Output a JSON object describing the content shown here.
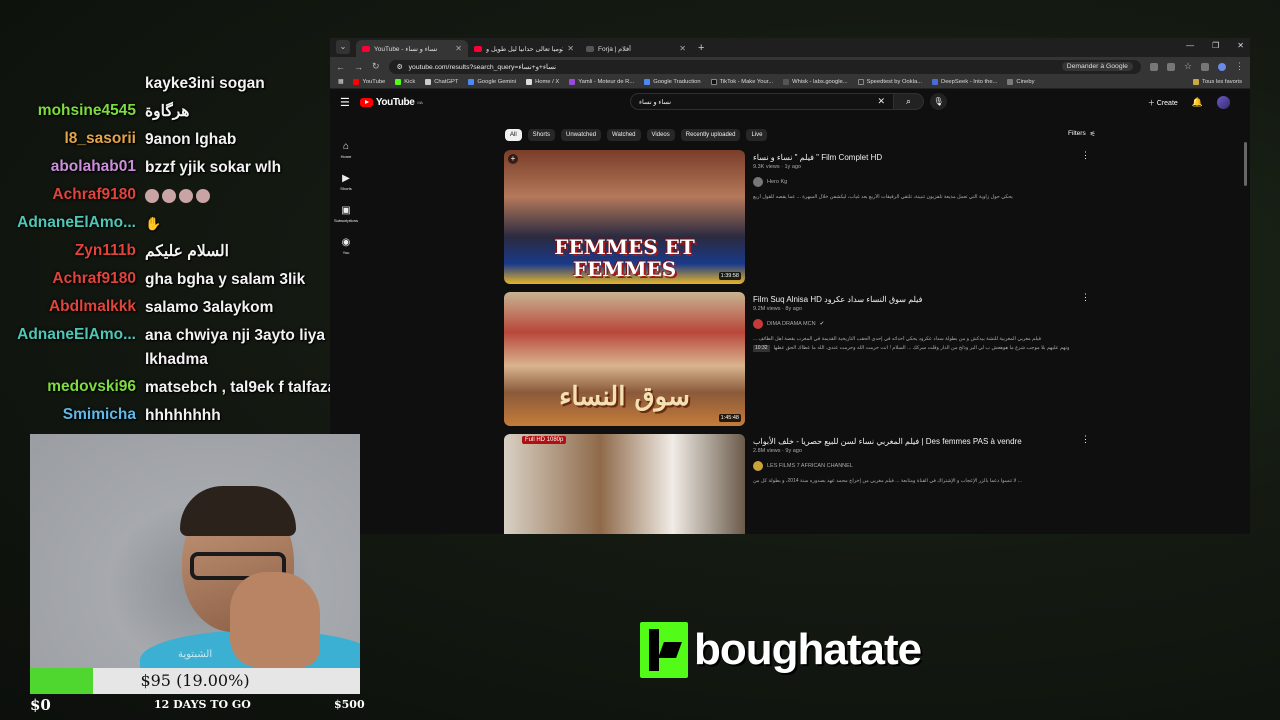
{
  "chat": [
    {
      "user": "",
      "color": "#ffffff",
      "msg": "kayke3ini sogan"
    },
    {
      "user": "mohsine4545",
      "color": "#7ddc3f",
      "msg": "هرگاوة"
    },
    {
      "user": "l8_sasorii",
      "color": "#e3a44a",
      "msg": "9anon lghab"
    },
    {
      "user": "abolahab01",
      "color": "#c98fd8",
      "msg": "bzzf yjik sokar wlh"
    },
    {
      "user": "Achraf9180",
      "color": "#e0443c",
      "msg": ""
    },
    {
      "user": "AdnaneElAmo...",
      "color": "#4fc6b6",
      "msg": ""
    },
    {
      "user": "Zyn111b",
      "color": "#e0443c",
      "msg": "السلام عليكم"
    },
    {
      "user": "Achraf9180",
      "color": "#e0443c",
      "msg": "gha bgha y salam 3lik"
    },
    {
      "user": "Abdlmalkkk",
      "color": "#e0443c",
      "msg": "salamo 3alaykom"
    },
    {
      "user": "AdnaneElAmo...",
      "color": "#4fc6b6",
      "msg": "ana chwiya nji 3ayto liya lkhadma"
    },
    {
      "user": "medovski96",
      "color": "#7ddc3f",
      "msg": "matsebch , tal9ek f talfaza"
    },
    {
      "user": "Smimicha",
      "color": "#5fb8e8",
      "msg": "hhhhhhhh"
    }
  ],
  "browser": {
    "tabs": [
      {
        "title": "YouTube - نساء و نساء",
        "active": true
      },
      {
        "title": "الكوميا تعالى حدانيا ليل طويل و ...",
        "active": false
      },
      {
        "title": "Forja | أفلام",
        "active": false
      }
    ],
    "url": "youtube.com/results?search_query=نساء+و+نساء",
    "omni_action": "Demander à Google",
    "bookmarks": [
      "YouTube",
      "Kick",
      "ChatGPT",
      "Google Gemini",
      "Home / X",
      "Yamli - Moteur de R...",
      "Google Traduction",
      "TikTok - Make Your...",
      "Whisk - labs.google...",
      "Speedtest by Ookla...",
      "DeepSeek - Into the...",
      "Cineby"
    ],
    "bookmarks_all": "Tous les favoris"
  },
  "youtube": {
    "logo": "YouTube",
    "region": "MA",
    "search_query": "نساء و نساء",
    "create_label": "Create",
    "sidebar": [
      "Home",
      "Shorts",
      "Subscriptions",
      "You"
    ],
    "chips": [
      "All",
      "Shorts",
      "Unwatched",
      "Watched",
      "Videos",
      "Recently uploaded",
      "Live"
    ],
    "filters_label": "Filters",
    "results": [
      {
        "title": "فيلم \" نساء و نساء \" Film Complet HD",
        "stats": "9.3K views · 1y ago",
        "channel": "Hero Kg",
        "desc": "يحكي حول زاوية التي تعمل مذيعة تلفزيون تتبينة، تلتقي الرفيقات الأربع بعد غياب، ليكشفن خلال السهرة ... عما يقصه للقول أربع",
        "duration": "1:39:58",
        "thumb_text": "FEMMES ET FEMMES",
        "chapter": ""
      },
      {
        "title": "Film Suq Alnisa HD فيلم سوق النساء سداد عكرود",
        "stats": "9.2M views · 8y ago",
        "channel": "DIMA DRAMA MCN",
        "desc": "فيلم مغربي المغربية للنشة بيدكش و من بطولة سداد عكرود يحكي أحداثه في إحدى الحقب التاريخية القديمة في المغرب بقصة اهل الطائف ...",
        "desc2": "ونهم عليهم بلا موجب شرع ما هوهعش ب لي البر وذلح من الدار وقلت سركك ... السلام ! انت حرمت الله وحرمت عندي. الله ما عطاك الحق عطها",
        "duration": "1:45:48",
        "thumb_text": "سوق النساء",
        "chapter": "10:32"
      },
      {
        "title": "فيلم المغربي نساء لسن للبيع حصريا - خلف الأبواب | Des femmes PAS à vendre",
        "stats": "2.8M views · 9y ago",
        "channel": "LES FILMS 7 AFRICAN CHANNEL",
        "desc": "... لا تنسوا دعما بالزر الإعجاب و الإشتراك في القناة ومتابعة ... فيلم مغربي من إخراج محمد عهد بصدوره سنة 2014، و بطولة كل من",
        "duration": "",
        "thumb_text": "",
        "year": "2018",
        "hd": "Full HD 1080p",
        "chapter": ""
      }
    ]
  },
  "cam": {
    "watermark": "الشبتوية"
  },
  "goal": {
    "label": "$95 (19.00%)",
    "progress": 0.19,
    "min": "$0",
    "days": "12 DAYS TO GO",
    "max": "$500"
  },
  "brand": {
    "name": "boughatate"
  },
  "colors": {
    "accent": "#53fc18",
    "yt_red": "#ff0000"
  }
}
